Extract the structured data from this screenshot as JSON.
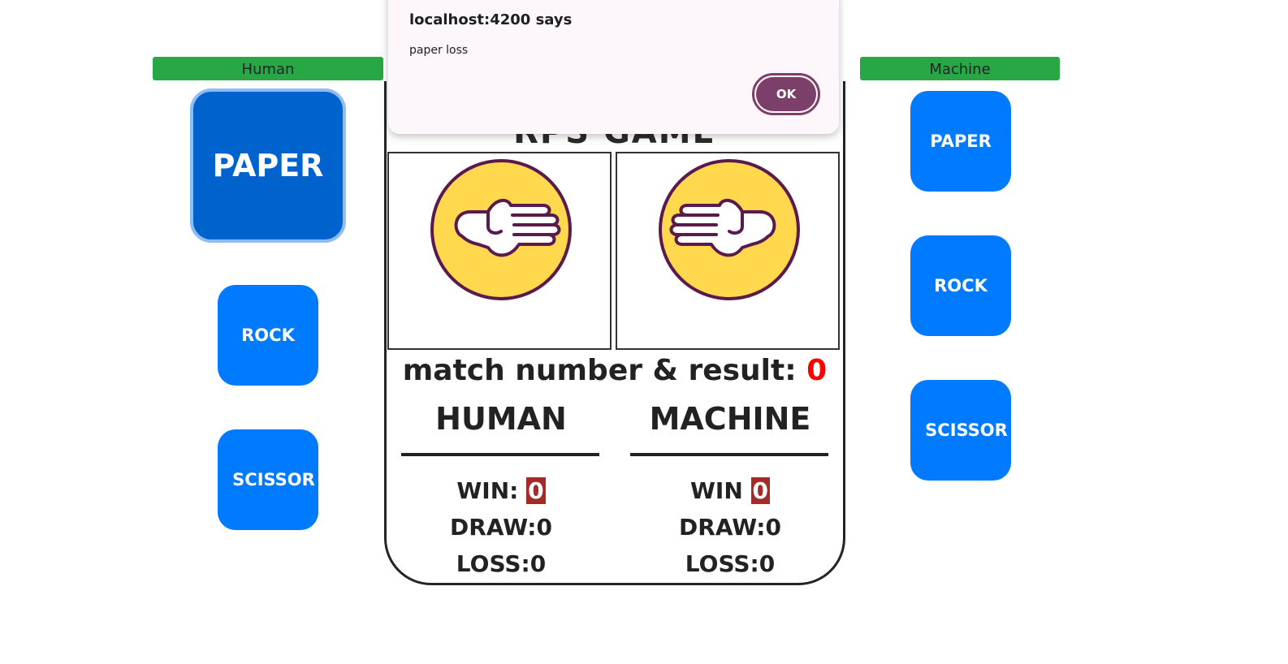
{
  "human": {
    "header": "Human",
    "choices": [
      "PAPER",
      "ROCK",
      "SCISSOR"
    ],
    "selected": "PAPER"
  },
  "machine": {
    "header": "Machine",
    "choices": [
      "PAPER",
      "ROCK",
      "SCISSOR"
    ]
  },
  "board": {
    "title": "RPS GAME",
    "human_hand_icon": "paper-hand-icon",
    "machine_hand_icon": "paper-hand-icon",
    "result_label": "match number & result: ",
    "result_value": "0",
    "human_col": {
      "title": "HUMAN",
      "win_label": "WIN: ",
      "win_value": "0",
      "draw": "DRAW:0",
      "loss": "LOSS:0"
    },
    "machine_col": {
      "title": "MACHINE",
      "win_label": "WIN ",
      "win_value": "0",
      "draw": "DRAW:0",
      "loss": "LOSS:0"
    }
  },
  "dialog": {
    "title": "localhost:4200 says",
    "message": "paper loss",
    "ok_label": "OK"
  },
  "colors": {
    "header_green": "#28a745",
    "button_blue": "#007bff",
    "selected_blue": "#0062cc",
    "win_badge": "#a52a2a",
    "result_red": "#ff0000",
    "dialog_ok": "#7b3f6a",
    "hand_circle": "#ffd84d",
    "hand_outline": "#5a1a4e"
  }
}
